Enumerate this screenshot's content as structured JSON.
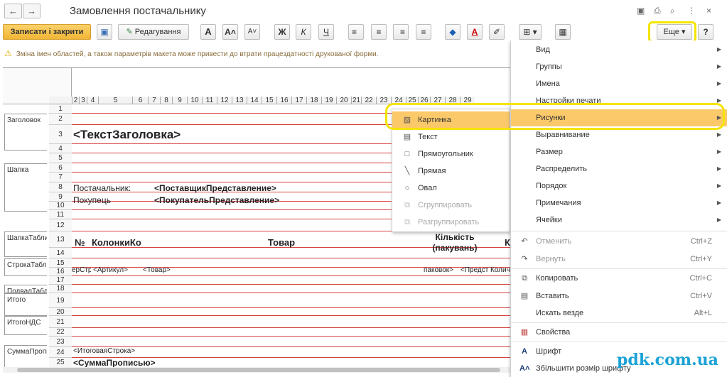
{
  "window": {
    "title": "Замовлення постачальнику",
    "back": "←",
    "forward": "→",
    "icons": [
      "save-doc-icon",
      "print-icon",
      "preview-icon",
      "more-dots-icon",
      "close-icon"
    ],
    "icon_glyphs": [
      "▣",
      "⎙",
      "⌕",
      "⋮",
      "×"
    ]
  },
  "toolbar": {
    "save_close": "Записати і закрити",
    "save_glyph": "▣",
    "edit_glyph": "✎",
    "edit": "Редагування",
    "font_large": "A",
    "font_up": "A˄",
    "font_down": "A˅",
    "bold": "Ж",
    "italic": "К",
    "underline": "Ч",
    "align_left": "≡",
    "align_center": "≡",
    "align_right": "≡",
    "justify": "≡",
    "fill": "◆",
    "text_color": "A",
    "pen": "✐",
    "borders": "⊞ ▾",
    "grid": "▦",
    "more": "Еще ▾",
    "help": "?"
  },
  "warning": {
    "glyph": "⚠",
    "text": "Зміна імен областей, а також параметрів макета може привести до втрати працездатності друкованої форми."
  },
  "sheet": {
    "col_headers": [
      "2",
      "3",
      "4",
      "5",
      "6",
      "7",
      "8",
      "9",
      "10",
      "11",
      "12",
      "13",
      "14",
      "15",
      "16",
      "17",
      "18",
      "19",
      "20",
      "21",
      "22",
      "23",
      "24",
      "25",
      "26",
      "27",
      "28",
      "29"
    ],
    "row_numbers": [
      "1",
      "2",
      "3",
      "4",
      "5",
      "6",
      "7",
      "8",
      "9",
      "10",
      "11",
      "12",
      "13",
      "14",
      "15",
      "16",
      "17",
      "18",
      "19",
      "20",
      "21",
      "22",
      "23",
      "24",
      "25"
    ],
    "groups": [
      "Заголовок",
      "Шапка",
      "ШапкаТаблиц",
      "СтрокаТаблиц",
      "ПодвалТаблиц",
      "Итого",
      "ИтогоНДС",
      "СуммаПропис"
    ],
    "cells": {
      "header_title": "<ТекстЗаголовка>",
      "supplier_label": "Постачальник:",
      "supplier_value": "<ПоставщикПредставление>",
      "buyer_label": "Покупець",
      "buyer_value": "<ПокупательПредставление>",
      "col_no": "№",
      "col_columns": "КолонкиКо",
      "col_goods": "Товар",
      "col_qty": "Кількість (пакувань)",
      "col_k": "К",
      "row_num": "ерСтр",
      "row_article": "<Артикул>",
      "row_goods": "<Товар>",
      "row_packs": "паковок>",
      "row_repr": "<Предст",
      "row_qty": "Количе",
      "total_line": "<ИтоговаяСтрока>",
      "sum_words": "<СуммаПрописью>"
    }
  },
  "submenu": {
    "items": [
      {
        "label": "Картинка",
        "icon": "picture-icon",
        "glyph": "▨"
      },
      {
        "label": "Текст",
        "icon": "text-icon",
        "glyph": "▤"
      },
      {
        "label": "Прямоугольник",
        "icon": "rectangle-icon",
        "glyph": "□"
      },
      {
        "label": "Прямая",
        "icon": "line-icon",
        "glyph": "╲"
      },
      {
        "label": "Овал",
        "icon": "oval-icon",
        "glyph": "○"
      },
      {
        "label": "Сгруппировать",
        "icon": "group-icon",
        "glyph": "⧉"
      },
      {
        "label": "Разгруппировать",
        "icon": "ungroup-icon",
        "glyph": "⧉"
      }
    ]
  },
  "menu": {
    "items": [
      {
        "label": "Вид",
        "arrow": "▶"
      },
      {
        "label": "Группы",
        "arrow": "▶"
      },
      {
        "label": "Имена",
        "arrow": "▶"
      },
      {
        "label": "Настройки печати",
        "arrow": "▶"
      },
      {
        "label": "Рисунки",
        "arrow": "▶"
      },
      {
        "label": "Выравнивание",
        "arrow": "▶"
      },
      {
        "label": "Размер",
        "arrow": "▶"
      },
      {
        "label": "Распределить",
        "arrow": "▶"
      },
      {
        "label": "Порядок",
        "arrow": "▶"
      },
      {
        "label": "Примечания",
        "arrow": "▶"
      },
      {
        "label": "Ячейки",
        "arrow": "▶"
      }
    ],
    "undo": {
      "label": "Отменить",
      "shortcut": "Ctrl+Z",
      "glyph": "↶"
    },
    "redo": {
      "label": "Вернуть",
      "shortcut": "Ctrl+Y",
      "glyph": "↷"
    },
    "copy": {
      "label": "Копировать",
      "shortcut": "Ctrl+C",
      "glyph": "⧉"
    },
    "paste": {
      "label": "Вставить",
      "shortcut": "Ctrl+V",
      "glyph": "▤"
    },
    "find": {
      "label": "Искать везде",
      "shortcut": "Alt+L"
    },
    "properties": {
      "label": "Свойства",
      "glyph": "▦"
    },
    "font": {
      "label": "Шрифт",
      "glyph": "A"
    },
    "font_up": {
      "label": "Збільшити розмір шрифту",
      "glyph": "A˄"
    }
  },
  "watermark": "pdk.com.ua"
}
